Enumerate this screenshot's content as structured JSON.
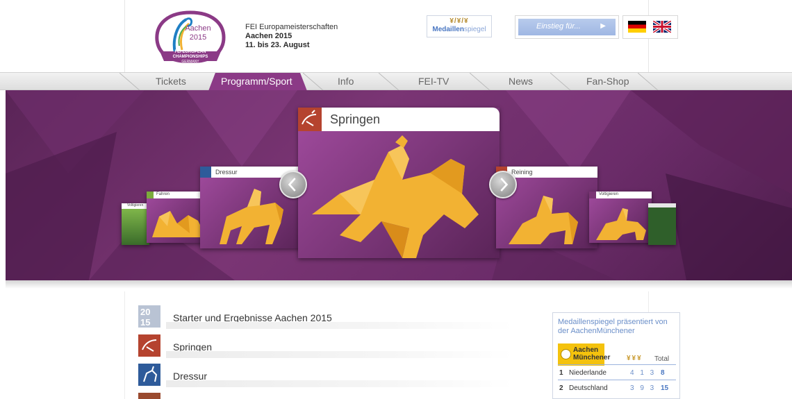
{
  "header": {
    "logo": {
      "city": "Aachen",
      "year": "2015",
      "line1": "FEI EUROPEAN",
      "line2": "CHAMPIONSHIPS",
      "line3": "GERMANY"
    },
    "event_line1": "FEI Europameisterschaften",
    "event_line2": "Aachen 2015",
    "event_line3": "11. bis 23. August",
    "medal_button": {
      "bold": "Medaillen",
      "rest": "spiegel",
      "icons": "¥/¥/¥"
    },
    "entry_button": {
      "label": "Einstieg für...",
      "arrow": "▶"
    },
    "languages": [
      "german-flag",
      "uk-flag"
    ]
  },
  "nav": {
    "items": [
      "Tickets",
      "Programm/Sport",
      "Info",
      "FEI-TV",
      "News",
      "Fan-Shop"
    ],
    "active": "Programm/Sport"
  },
  "carousel": {
    "main": "Springen",
    "left_1": "Dressur",
    "left_2": "Fahren",
    "left_3": "Voltigieren",
    "right_1": "Reining",
    "right_2": "Voltigieren",
    "colors": {
      "gold": "#f2b233",
      "purple": "#7a3574"
    }
  },
  "list": {
    "items": [
      {
        "label": "Starter und Ergebnisse Aachen 2015",
        "badge": "2015",
        "color": "#b9c3d4"
      },
      {
        "label": "Springen",
        "badge": "jump",
        "color": "#b5432f"
      },
      {
        "label": "Dressur",
        "badge": "dressage",
        "color": "#2e5b9a"
      },
      {
        "label": "",
        "badge": "driving",
        "color": "#9a4a2f"
      }
    ]
  },
  "medal_widget": {
    "heading": "Medaillenspiegel präsentiert von der AachenMünchener",
    "sponsor_line1": "Aachen",
    "sponsor_line2": "Münchener",
    "medal_icons": "¥¥¥",
    "total_label": "Total",
    "rows": [
      {
        "rank": "1",
        "country": "Niederlande",
        "counts": "4 1 3",
        "total": "8"
      },
      {
        "rank": "2",
        "country": "Deutschland",
        "counts": "3 9 3",
        "total": "15"
      }
    ]
  }
}
